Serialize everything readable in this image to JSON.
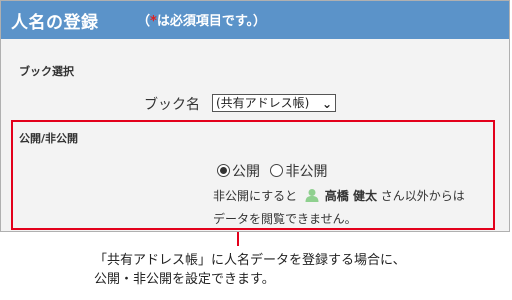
{
  "header": {
    "title": "人名の登録",
    "note_open": "（",
    "note_star": "*",
    "note_rest": "は必須項目です。）"
  },
  "book_section": {
    "heading": "ブック選択",
    "field_label": "ブック名",
    "selected": "(共有アドレス帳)"
  },
  "visibility_section": {
    "heading": "公開/非公開",
    "options": [
      {
        "label": "公開",
        "checked": true
      },
      {
        "label": "非公開",
        "checked": false
      }
    ],
    "desc_prefix": "非公開にすると",
    "user_name": "高橋 健太",
    "desc_suffix": "さん以外からは",
    "desc_line2": "データを閲覧できません。"
  },
  "caption": {
    "line1": "「共有アドレス帳」に人名データを登録する場合に、",
    "line2": "公開・非公開を設定できます。"
  },
  "colors": {
    "header_bg": "#5b93c9",
    "highlight": "#e3001b",
    "required_star": "#e02020",
    "user_icon": "#8fd08f"
  }
}
